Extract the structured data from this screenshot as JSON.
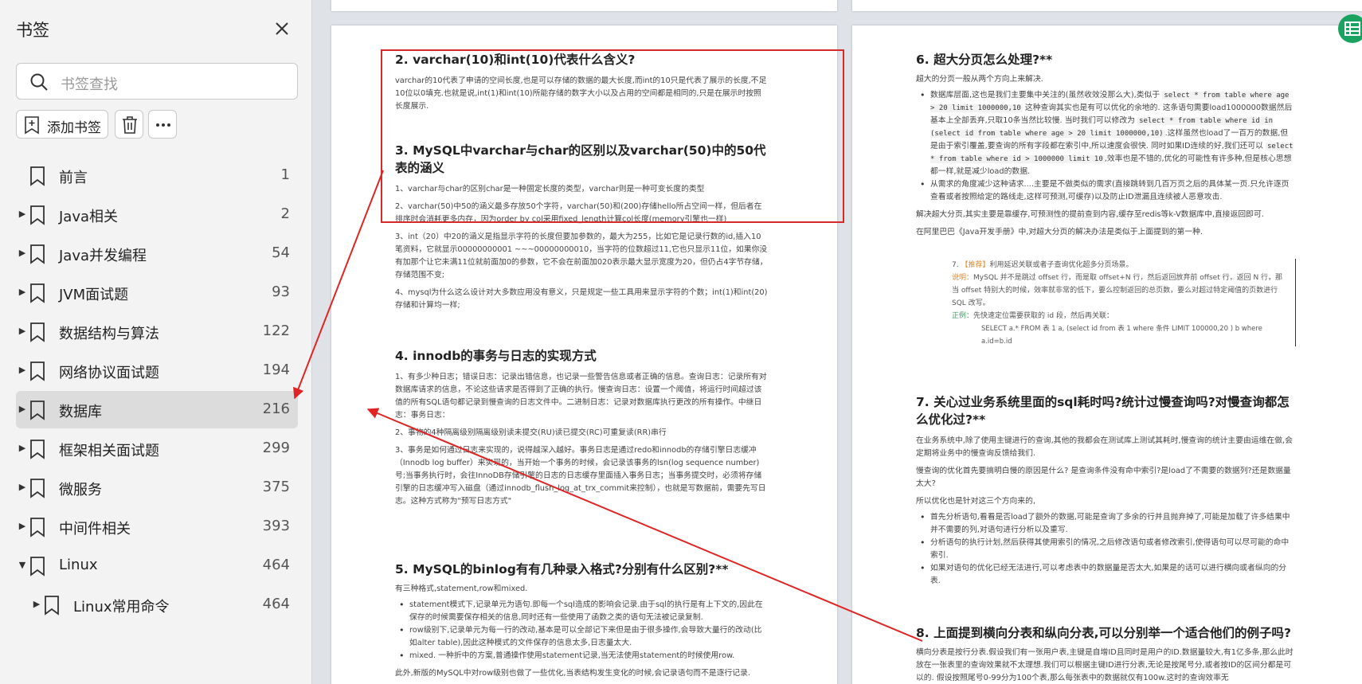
{
  "sidebar": {
    "title": "书签",
    "close_icon": "close-icon",
    "search": {
      "placeholder": "书签查找",
      "icon": "search-icon"
    },
    "toolbar": {
      "add_label": "添加书签",
      "delete_icon": "trash-icon",
      "more_icon": "more-icon"
    },
    "items": [
      {
        "label": "前言",
        "count": "1",
        "expandable": false,
        "expanded": false,
        "level": 0,
        "active": false
      },
      {
        "label": "Java相关",
        "count": "2",
        "expandable": true,
        "expanded": false,
        "level": 0,
        "active": false
      },
      {
        "label": "Java并发编程",
        "count": "54",
        "expandable": true,
        "expanded": false,
        "level": 0,
        "active": false
      },
      {
        "label": "JVM面试题",
        "count": "93",
        "expandable": true,
        "expanded": false,
        "level": 0,
        "active": false
      },
      {
        "label": "数据结构与算法",
        "count": "122",
        "expandable": true,
        "expanded": false,
        "level": 0,
        "active": false
      },
      {
        "label": "网络协议面试题",
        "count": "194",
        "expandable": true,
        "expanded": false,
        "level": 0,
        "active": false
      },
      {
        "label": "数据库",
        "count": "216",
        "expandable": true,
        "expanded": false,
        "level": 0,
        "active": true
      },
      {
        "label": "框架相关面试题",
        "count": "299",
        "expandable": true,
        "expanded": false,
        "level": 0,
        "active": false
      },
      {
        "label": "微服务",
        "count": "375",
        "expandable": true,
        "expanded": false,
        "level": 0,
        "active": false
      },
      {
        "label": "中间件相关",
        "count": "393",
        "expandable": true,
        "expanded": false,
        "level": 0,
        "active": false
      },
      {
        "label": "Linux",
        "count": "464",
        "expandable": true,
        "expanded": true,
        "level": 0,
        "active": false
      },
      {
        "label": "Linux常用命令",
        "count": "464",
        "expandable": true,
        "expanded": false,
        "level": 1,
        "active": false
      }
    ]
  },
  "left_page": {
    "s2_title": "2. varchar(10)和int(10)代表什么含义?",
    "s2_p1": "varchar的10代表了申请的空间长度,也是可以存储的数据的最大长度,而int的10只是代表了展示的长度,不足10位以0填充.也就是说,int(1)和int(10)所能存储的数字大小以及占用的空间都是相同的,只是在展示时按照长度展示.",
    "s3_title": "3. MySQL中varchar与char的区别以及varchar(50)中的50代表的涵义",
    "s3_p1": "1、varchar与char的区别char是一种固定长度的类型，varchar则是一种可变长度的类型",
    "s3_p2": "2、varchar(50)中50的涵义最多存放50个字符，varchar(50)和(200)存储hello所占空间一样，但后者在排序时会消耗更多内存，因为order by col采用fixed_length计算col长度(memory引擎也一样)",
    "s3_p3": "3、int（20）中20的涵义是指显示字符的长度但要加参数的，最大为255，比如它是记录行数的id,插入10笔资料，它就显示00000000001 ~~~00000000010，当字符的位数超过11,它也只显示11位，如果你没有加那个让它未满11位就前面加0的参数，它不会在前面加020表示最大显示宽度为20，但仍占4字节存储，存储范围不变;",
    "s3_p4": "4、mysql为什么这么设计对大多数应用没有意义，只是规定一些工具用来显示字符的个数；int(1)和int(20)存储和计算均一样;",
    "s4_title": "4. innodb的事务与日志的实现方式",
    "s4_p1": "1、有多少种日志；错误日志：记录出错信息，也记录一些警告信息或者正确的信息。查询日志：记录所有对数据库请求的信息，不论这些请求是否得到了正确的执行。慢查询日志：设置一个阈值，将运行时间超过该值的所有SQL语句都记录到慢查询的日志文件中。二进制日志：记录对数据库执行更改的所有操作。中继日志：事务日志：",
    "s4_p2": "2、事物的4种隔离级别隔离级别读未提交(RU)读已提交(RC)可重复读(RR)串行",
    "s4_p3": "3、事务是如何通过日志来实现的，说得越深入越好。事务日志是通过redo和innodb的存储引擎日志缓冲（Innodb log buffer）来实现的，当开始一个事务的时候，会记录该事务的lsn(log sequence number)号;当事务执行时，会往InnoDB存储引擎的日志的日志缓存里面插入事务日志；当事务提交时，必须将存储引擎的日志缓冲写入磁盘（通过innodb_flush_log_at_trx_commit来控制），也就是写数据前，需要先写日志。这种方式称为\"预写日志方式\"",
    "s5_title": "5. MySQL的binlog有有几种录入格式?分别有什么区别?**",
    "s5_p1": "有三种格式,statement,row和mixed.",
    "s5_li1": "statement模式下,记录单元为语句.即每一个sql造成的影响会记录.由于sql的执行是有上下文的,因此在保存的时候需要保存相关的信息,同时还有一些使用了函数之类的语句无法被记录复制.",
    "s5_li2": "row级别下,记录单元为每一行的改动,基本是可以全部记下来但是由于很多操作,会导致大量行的改动(比如alter table),因此这种模式的文件保存的信息太多,日志量太大.",
    "s5_li3": "mixed. 一种折中的方案,普通操作使用statement记录,当无法使用statement的时候使用row.",
    "s5_p2": "此外,新版的MySQL中对row级别也做了一些优化,当表结构发生变化的时候,会记录语句而不是逐行记录."
  },
  "right_page": {
    "s6_title": "6. 超大分页怎么处理?**",
    "s6_p1": "超大的分页一般从两个方向上来解决.",
    "s6_li1_a": "数据库层面,这也是我们主要集中关注的(虽然收效没那么大),类似于",
    "s6_code1": "select * from table where age > 20 limit 1000000,10",
    "s6_li1_b": "这种查询其实也是有可以优化的余地的. 这条语句需要load1000000数据然后基本上全部丢弃,只取10条当然比较慢. 当时我们可以修改为",
    "s6_code2": "select * from table where id in (select id from table where age > 20 limit 1000000,10)",
    "s6_li1_c": ".这样虽然也load了一百万的数据,但是由于索引覆盖,要查询的所有字段都在索引中,所以速度会很快. 同时如果ID连续的好,我们还可以",
    "s6_code3": "select * from table where id > 1000000 limit 10",
    "s6_li1_d": ",效率也是不错的,优化的可能性有许多种,但是核心思想都一样,就是减少load的数据.",
    "s6_li2": "从需求的角度减少这种请求....主要是不做类似的需求(直接跳转到几百万页之后的具体某一页.只允许逐页查看或者按照给定的路线走,这样可预测,可缓存)以及防止ID泄漏且连续被人恶意攻击.",
    "s6_p2": "解决超大分页,其实主要是靠缓存,可预测性的提前查到内容,缓存至redis等k-V数据库中,直接返回即可.",
    "s6_p3": "在阿里巴巴《Java开发手册》中,对超大分页的解决办法是类似于上面提到的第一种.",
    "quote_l1_a": "7. ",
    "quote_l1_tag": "【推荐】",
    "quote_l1_b": "利用延迟关联或者子查询优化超多分页场景。",
    "quote_l2_tag": "说明：",
    "quote_l2": "MySQL 并不是跳过 offset 行，而是取 offset+N 行，然后返回放弃前 offset 行，返回 N 行，那当 offset 特别大的时候，效率就非常的低下，要么控制返回的总页数，要么对超过特定阈值的页数进行 SQL 改写。",
    "quote_l3_tag": "正例：",
    "quote_l3": "先快速定位需要获取的 id 段，然后再关联：",
    "quote_l4": "SELECT a.* FROM 表 1 a, (select id from 表 1 where 条件 LIMIT 100000,20 ) b where a.id=b.id",
    "s7_title": "7. 关心过业务系统里面的sql耗时吗?统计过慢查询吗?对慢查询都怎么优化过?**",
    "s7_p1": "在业务系统中,除了使用主键进行的查询,其他的我都会在测试库上测试其耗时,慢查询的统计主要由运维在做,会定期将业务中的慢查询反馈给我们.",
    "s7_p2": "慢查询的优化首先要搞明白慢的原因是什么? 是查询条件没有命中索引?是load了不需要的数据列?还是数据量太大?",
    "s7_p3": "所以优化也是针对这三个方向来的,",
    "s7_li1": "首先分析语句,看看是否load了额外的数据,可能是查询了多余的行并且抛弃掉了,可能是加载了许多结果中并不需要的列,对语句进行分析以及重写.",
    "s7_li2": "分析语句的执行计划,然后获得其使用索引的情况,之后修改语句或者修改索引,使得语句可以尽可能的命中索引.",
    "s7_li3": "如果对语句的优化已经无法进行,可以考虑表中的数据量是否太大,如果是的话可以进行横向或者纵向的分表.",
    "s8_title": "8. 上面提到横向分表和纵向分表,可以分别举一个适合他们的例子吗?",
    "s8_p1": "横向分表是按行分表.假设我们有一张用户表,主键是自增ID且同时是用户的ID.数据量较大,有1亿多条,那么此时放在一张表里的查询效果就不太理想.我们可以根据主键ID进行分表,无论是按尾号分,或者按ID的区间分都是可以的. 假设按照尾号0-99分为100个表,那么每张表中的数据就仅有100w.这时的查询效率无"
  },
  "annotations": {
    "box_color": "#d62a2a",
    "arrow_color": "#e02424"
  },
  "floating_button_icon": "grid-icon"
}
